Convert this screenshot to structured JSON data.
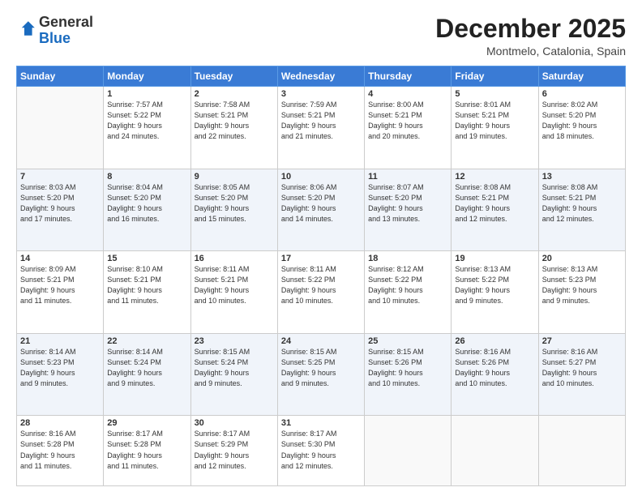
{
  "logo": {
    "general": "General",
    "blue": "Blue"
  },
  "header": {
    "month": "December 2025",
    "location": "Montmelo, Catalonia, Spain"
  },
  "weekdays": [
    "Sunday",
    "Monday",
    "Tuesday",
    "Wednesday",
    "Thursday",
    "Friday",
    "Saturday"
  ],
  "weeks": [
    [
      {
        "day": "",
        "lines": []
      },
      {
        "day": "1",
        "lines": [
          "Sunrise: 7:57 AM",
          "Sunset: 5:22 PM",
          "Daylight: 9 hours",
          "and 24 minutes."
        ]
      },
      {
        "day": "2",
        "lines": [
          "Sunrise: 7:58 AM",
          "Sunset: 5:21 PM",
          "Daylight: 9 hours",
          "and 22 minutes."
        ]
      },
      {
        "day": "3",
        "lines": [
          "Sunrise: 7:59 AM",
          "Sunset: 5:21 PM",
          "Daylight: 9 hours",
          "and 21 minutes."
        ]
      },
      {
        "day": "4",
        "lines": [
          "Sunrise: 8:00 AM",
          "Sunset: 5:21 PM",
          "Daylight: 9 hours",
          "and 20 minutes."
        ]
      },
      {
        "day": "5",
        "lines": [
          "Sunrise: 8:01 AM",
          "Sunset: 5:21 PM",
          "Daylight: 9 hours",
          "and 19 minutes."
        ]
      },
      {
        "day": "6",
        "lines": [
          "Sunrise: 8:02 AM",
          "Sunset: 5:20 PM",
          "Daylight: 9 hours",
          "and 18 minutes."
        ]
      }
    ],
    [
      {
        "day": "7",
        "lines": [
          "Sunrise: 8:03 AM",
          "Sunset: 5:20 PM",
          "Daylight: 9 hours",
          "and 17 minutes."
        ]
      },
      {
        "day": "8",
        "lines": [
          "Sunrise: 8:04 AM",
          "Sunset: 5:20 PM",
          "Daylight: 9 hours",
          "and 16 minutes."
        ]
      },
      {
        "day": "9",
        "lines": [
          "Sunrise: 8:05 AM",
          "Sunset: 5:20 PM",
          "Daylight: 9 hours",
          "and 15 minutes."
        ]
      },
      {
        "day": "10",
        "lines": [
          "Sunrise: 8:06 AM",
          "Sunset: 5:20 PM",
          "Daylight: 9 hours",
          "and 14 minutes."
        ]
      },
      {
        "day": "11",
        "lines": [
          "Sunrise: 8:07 AM",
          "Sunset: 5:20 PM",
          "Daylight: 9 hours",
          "and 13 minutes."
        ]
      },
      {
        "day": "12",
        "lines": [
          "Sunrise: 8:08 AM",
          "Sunset: 5:21 PM",
          "Daylight: 9 hours",
          "and 12 minutes."
        ]
      },
      {
        "day": "13",
        "lines": [
          "Sunrise: 8:08 AM",
          "Sunset: 5:21 PM",
          "Daylight: 9 hours",
          "and 12 minutes."
        ]
      }
    ],
    [
      {
        "day": "14",
        "lines": [
          "Sunrise: 8:09 AM",
          "Sunset: 5:21 PM",
          "Daylight: 9 hours",
          "and 11 minutes."
        ]
      },
      {
        "day": "15",
        "lines": [
          "Sunrise: 8:10 AM",
          "Sunset: 5:21 PM",
          "Daylight: 9 hours",
          "and 11 minutes."
        ]
      },
      {
        "day": "16",
        "lines": [
          "Sunrise: 8:11 AM",
          "Sunset: 5:21 PM",
          "Daylight: 9 hours",
          "and 10 minutes."
        ]
      },
      {
        "day": "17",
        "lines": [
          "Sunrise: 8:11 AM",
          "Sunset: 5:22 PM",
          "Daylight: 9 hours",
          "and 10 minutes."
        ]
      },
      {
        "day": "18",
        "lines": [
          "Sunrise: 8:12 AM",
          "Sunset: 5:22 PM",
          "Daylight: 9 hours",
          "and 10 minutes."
        ]
      },
      {
        "day": "19",
        "lines": [
          "Sunrise: 8:13 AM",
          "Sunset: 5:22 PM",
          "Daylight: 9 hours",
          "and 9 minutes."
        ]
      },
      {
        "day": "20",
        "lines": [
          "Sunrise: 8:13 AM",
          "Sunset: 5:23 PM",
          "Daylight: 9 hours",
          "and 9 minutes."
        ]
      }
    ],
    [
      {
        "day": "21",
        "lines": [
          "Sunrise: 8:14 AM",
          "Sunset: 5:23 PM",
          "Daylight: 9 hours",
          "and 9 minutes."
        ]
      },
      {
        "day": "22",
        "lines": [
          "Sunrise: 8:14 AM",
          "Sunset: 5:24 PM",
          "Daylight: 9 hours",
          "and 9 minutes."
        ]
      },
      {
        "day": "23",
        "lines": [
          "Sunrise: 8:15 AM",
          "Sunset: 5:24 PM",
          "Daylight: 9 hours",
          "and 9 minutes."
        ]
      },
      {
        "day": "24",
        "lines": [
          "Sunrise: 8:15 AM",
          "Sunset: 5:25 PM",
          "Daylight: 9 hours",
          "and 9 minutes."
        ]
      },
      {
        "day": "25",
        "lines": [
          "Sunrise: 8:15 AM",
          "Sunset: 5:26 PM",
          "Daylight: 9 hours",
          "and 10 minutes."
        ]
      },
      {
        "day": "26",
        "lines": [
          "Sunrise: 8:16 AM",
          "Sunset: 5:26 PM",
          "Daylight: 9 hours",
          "and 10 minutes."
        ]
      },
      {
        "day": "27",
        "lines": [
          "Sunrise: 8:16 AM",
          "Sunset: 5:27 PM",
          "Daylight: 9 hours",
          "and 10 minutes."
        ]
      }
    ],
    [
      {
        "day": "28",
        "lines": [
          "Sunrise: 8:16 AM",
          "Sunset: 5:28 PM",
          "Daylight: 9 hours",
          "and 11 minutes."
        ]
      },
      {
        "day": "29",
        "lines": [
          "Sunrise: 8:17 AM",
          "Sunset: 5:28 PM",
          "Daylight: 9 hours",
          "and 11 minutes."
        ]
      },
      {
        "day": "30",
        "lines": [
          "Sunrise: 8:17 AM",
          "Sunset: 5:29 PM",
          "Daylight: 9 hours",
          "and 12 minutes."
        ]
      },
      {
        "day": "31",
        "lines": [
          "Sunrise: 8:17 AM",
          "Sunset: 5:30 PM",
          "Daylight: 9 hours",
          "and 12 minutes."
        ]
      },
      {
        "day": "",
        "lines": []
      },
      {
        "day": "",
        "lines": []
      },
      {
        "day": "",
        "lines": []
      }
    ]
  ]
}
